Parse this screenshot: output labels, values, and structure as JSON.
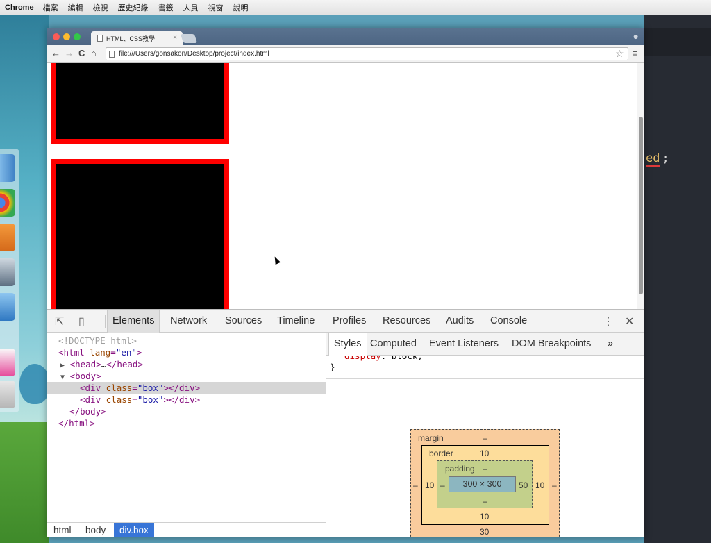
{
  "menubar": {
    "app": "Chrome",
    "items": [
      "檔案",
      "編輯",
      "檢視",
      "歷史紀錄",
      "書籤",
      "人員",
      "視窗",
      "說明"
    ]
  },
  "browser": {
    "tab_title": "HTML、CSS教學",
    "tab_close": "×",
    "url": "file:///Users/gonsakon/Desktop/project/index.html",
    "icons": {
      "back": "back-arrow-icon",
      "forward": "forward-arrow-icon",
      "reload": "reload-icon",
      "home": "home-icon",
      "bookmark": "star-icon",
      "menu": "hamburger-menu-icon"
    }
  },
  "devtools": {
    "tabs": [
      "Elements",
      "Network",
      "Sources",
      "Timeline",
      "Profiles",
      "Resources",
      "Audits",
      "Console"
    ],
    "active_tab": "Elements",
    "more_icon": "⋮",
    "close_icon": "✕",
    "dom": {
      "doctype": "<!DOCTYPE html>",
      "html_open": "html",
      "lang_attr": "lang",
      "lang_val": "\"en\"",
      "head": "head",
      "head_ellipsis": "…",
      "body": "body",
      "div": "div",
      "class_attr": "class",
      "class_val": "\"box\""
    },
    "breadcrumb": [
      "html",
      "body",
      "div.box"
    ],
    "styles_tabs": [
      "Styles",
      "Computed",
      "Event Listeners",
      "DOM Breakpoints"
    ],
    "styles_more": "»",
    "rule_prop": "display",
    "rule_value": "block;",
    "rule_close": "}",
    "box_model": {
      "margin_label": "margin",
      "margin_top": "–",
      "margin_left": "–",
      "margin_right": "–",
      "margin_bottom": "30",
      "border_label": "border",
      "border_top": "10",
      "border_left": "10",
      "border_right": "10",
      "border_bottom": "10",
      "padding_label": "padding",
      "padding_top": "–",
      "padding_left": "–",
      "padding_right": "50",
      "padding_bottom": "–",
      "content": "300 × 300"
    }
  },
  "editor": {
    "code_fragment": "ed",
    "code_semicolon": ";"
  },
  "colors": {
    "box_fill": "#000000",
    "box_border": "#ff0000",
    "selection": "#3875d7",
    "margin": "#f9cc9d",
    "border": "#fddd9b",
    "padding": "#c3d08b",
    "content": "#8cb6c0"
  }
}
